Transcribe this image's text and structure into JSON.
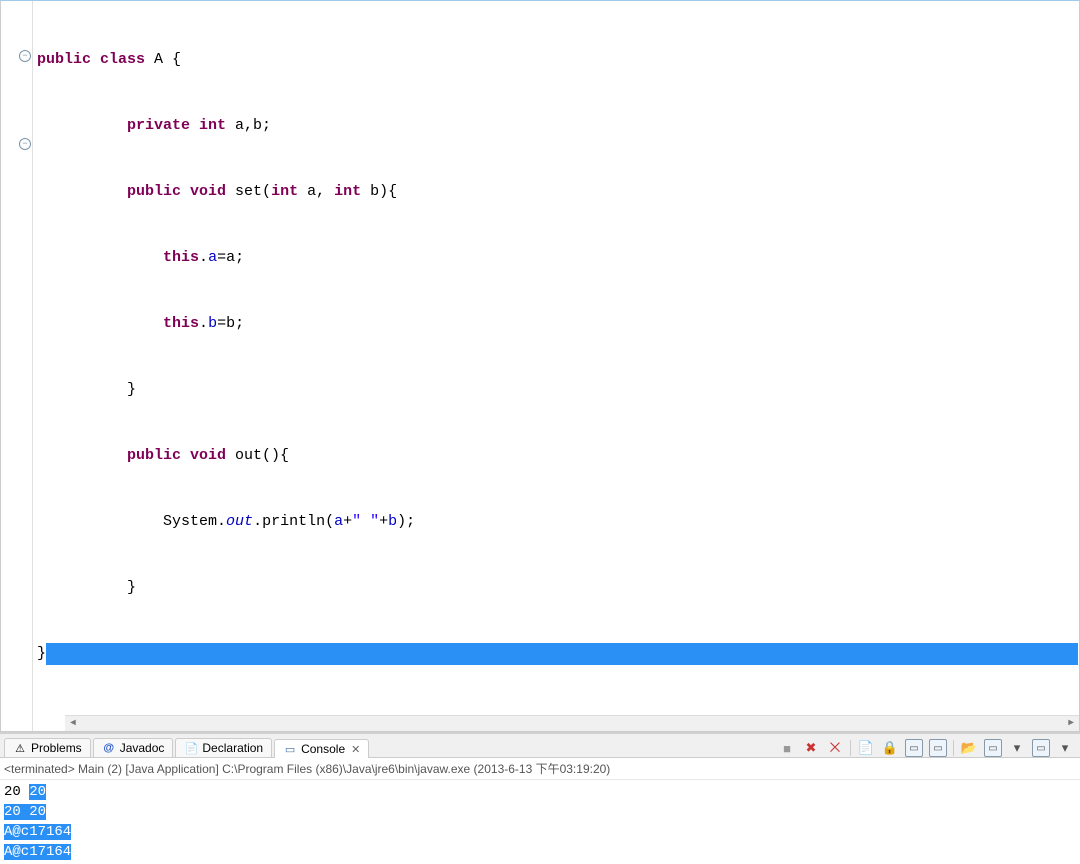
{
  "code": {
    "l1": {
      "a": "public class",
      "b": " A {"
    },
    "l2": {
      "a": "private int",
      "b": " a,b;"
    },
    "l3": {
      "a": "public void",
      "b": " set(",
      "c": "int",
      "d": " a, ",
      "e": "int",
      "f": " b){"
    },
    "l4": {
      "a": "this",
      "b": ".",
      "c": "a",
      "d": "=a;"
    },
    "l5": {
      "a": "this",
      "b": ".",
      "c": "b",
      "d": "=b;"
    },
    "l6": "}",
    "l7": {
      "a": "public void",
      "b": " out(){"
    },
    "l8": {
      "a": "System.",
      "b": "out",
      "c": ".println(",
      "d": "a",
      "e": "+",
      "f": "\" \"",
      "g": "+",
      "h": "b",
      "i": ");"
    },
    "l9": "}",
    "l10": "}"
  },
  "tabs": {
    "problems": "Problems",
    "javadoc": "Javadoc",
    "declaration": "Declaration",
    "console": "Console"
  },
  "icons": {
    "problems": "⚠",
    "javadoc": "@",
    "declaration": "📄",
    "console": "▭",
    "close": "✕",
    "stop": "■",
    "removex": "✖",
    "removexx": "⨉",
    "clear": "📄",
    "scrolllock": "🔒",
    "pin1": "▭",
    "pin2": "▭",
    "open": "📂",
    "min": "▭",
    "menu": "▾"
  },
  "console_header": "<terminated> Main (2) [Java Application] C:\\Program Files (x86)\\Java\\jre6\\bin\\javaw.exe (2013-6-13 下午03:19:20)",
  "console_out": {
    "line1": {
      "a": "20 ",
      "b": "20"
    },
    "line2": "20 20",
    "line3": "A@c17164",
    "line4": "A@c17164"
  },
  "chart_data": null
}
